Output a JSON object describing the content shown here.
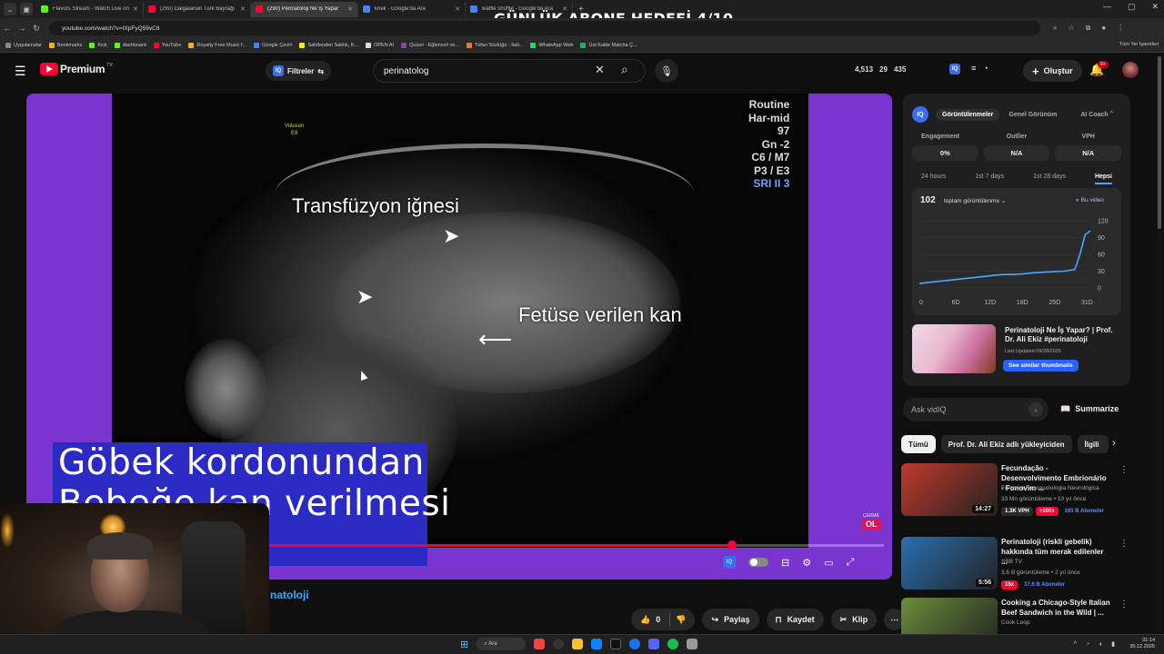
{
  "overlay_title": "GÜNLÜK ABONE HEDEFİ 4/10",
  "tabs": [
    {
      "label": "Flavors Stream - Watch Live on",
      "color": "#53fc18"
    },
    {
      "label": "(290) Dalgalanan Türk Bayrağı",
      "color": "#ff0033"
    },
    {
      "label": "(290) Perinatoloji Ne İş Yapar",
      "color": "#ff0033"
    },
    {
      "label": "kriek - Google'da Ara",
      "color": "#4285f4"
    },
    {
      "label": "waffle shuffle - Google'da Ara",
      "color": "#4285f4"
    }
  ],
  "url": "youtube.com/watch?v=tXpFyQ59vC8",
  "bookmarks": [
    {
      "label": "Uygulamalar",
      "color": "#888"
    },
    {
      "label": "Bookmarks",
      "color": "#f4b400"
    },
    {
      "label": "Kick",
      "color": "#53fc18"
    },
    {
      "label": "dashboard",
      "color": "#53fc18"
    },
    {
      "label": "YouTube",
      "color": "#ff0033"
    },
    {
      "label": "Royalty Free Music f...",
      "color": "#f4b400"
    },
    {
      "label": "Google Çeviri",
      "color": "#4285f4"
    },
    {
      "label": "Sahibinden Satılık, K...",
      "color": "#ffe800"
    },
    {
      "label": "OPEN AI",
      "color": "#ddd"
    },
    {
      "label": "Quizei - Eğlenceli ve...",
      "color": "#8e44ad"
    },
    {
      "label": "Tüfan Sözlüğü - İtali...",
      "color": "#e67e22"
    },
    {
      "label": "WhatsApp Web",
      "color": "#25d366"
    },
    {
      "label": "Üst Kalite Matcha Ç...",
      "color": "#27ae60"
    }
  ],
  "bookmarks_all": "Tüm Yer İşaretleri",
  "header": {
    "logo": "Premium",
    "logo_region": "TR",
    "filters": "Filtreler",
    "search_value": "perinatolog",
    "stats": [
      "4,513",
      "29",
      "435"
    ],
    "create": "Oluştur",
    "notif_badge": "9+"
  },
  "video": {
    "us_brand": "Voluson\nE8",
    "us_info": [
      "Routine",
      "Har-mid",
      "97",
      "Gn  -2",
      "C6 / M7",
      "P3 / E3"
    ],
    "us_info_blue": "SRI II 3",
    "label_needle": "Transfüzyon iğnesi",
    "label_blood": "Fetüse verilen kan",
    "caption": "Göbek kordonundan\nBebeğe kan verilmesi\nni",
    "live_badge_small": "ÇEKME",
    "live_badge": "OL",
    "progress": 0.756,
    "below_title": "natoloji"
  },
  "actions": {
    "like_count": "0",
    "share": "Paylaş",
    "save": "Kaydet",
    "clip": "Klip"
  },
  "vidiq": {
    "tabs": [
      "Görüntülenmeler",
      "Genel Görünüm",
      "AI Coach"
    ],
    "metrics_headers": [
      "Engagement",
      "Outlier",
      "VPH"
    ],
    "metrics_values": [
      "0%",
      "N/A",
      "N/A"
    ],
    "ranges": [
      "24 hours",
      "1st 7 days",
      "1st 28 days",
      "Hepsi"
    ],
    "count": "102",
    "selector": "toplam görüntülenme ⌄",
    "legend": "Bu video",
    "thumb_title": "Perinatoloji Ne İş Yapar? | Prof. Dr. Ali Ekiz #perinatoloji",
    "thumb_date": "Last Updated 09/28/2025",
    "thumb_button": "See similar thumbnails"
  },
  "chart_data": {
    "type": "line",
    "x_ticks": [
      "0",
      "6D",
      "12D",
      "18D",
      "25D",
      "31D"
    ],
    "y_ticks": [
      "120",
      "90",
      "60",
      "30",
      "0"
    ],
    "ylim": [
      0,
      120
    ],
    "xlim": [
      0,
      33
    ],
    "series": [
      {
        "name": "Bu video",
        "color": "#4aa8ff",
        "x": [
          0,
          2,
          4,
          6,
          8,
          10,
          12,
          14,
          16,
          18,
          20,
          22,
          24,
          26,
          28,
          30,
          31,
          32,
          33
        ],
        "y": [
          8,
          10,
          12,
          14,
          16,
          18,
          20,
          22,
          24,
          24,
          25,
          27,
          28,
          29,
          30,
          33,
          60,
          95,
          102
        ]
      }
    ]
  },
  "ask": {
    "placeholder": "Ask vidIQ",
    "summarize": "Summarize"
  },
  "chips": [
    "Tümü",
    "Prof. Dr. Ali Ekiz adlı yükleyiciden",
    "İlgili"
  ],
  "recommendations": [
    {
      "title": "Fecundação - Desenvolvimento Embrionário - Fonovim ...",
      "channel": "Fonovim Fonoaudiologia Neurológica",
      "meta": "33 Mn görüntüleme • 10 yıl önce",
      "duration": "14:27",
      "badges": [
        "1.3K VPH",
        ">100x",
        "165 B Aboneler"
      ],
      "thumb": "#c0392b"
    },
    {
      "title": "Perinatoloji (riskli gebelik) hakkında tüm merak edilenler ...",
      "channel": "SBB TV",
      "meta": "3,6 B görüntüleme • 2 yıl önce",
      "duration": "5:56",
      "badges": [
        "16x",
        "37,6 B Aboneler"
      ],
      "thumb": "#2a6fb0"
    },
    {
      "title": "Cooking a Chicago-Style Italian Beef Sandwich in the Wild | ...",
      "channel": "Cook Loop",
      "meta": "",
      "duration": "",
      "badges": [],
      "thumb": "#6b8e3a"
    }
  ],
  "taskbar": {
    "search": "Ara",
    "time": "01:14",
    "date": "30.12.2025"
  }
}
